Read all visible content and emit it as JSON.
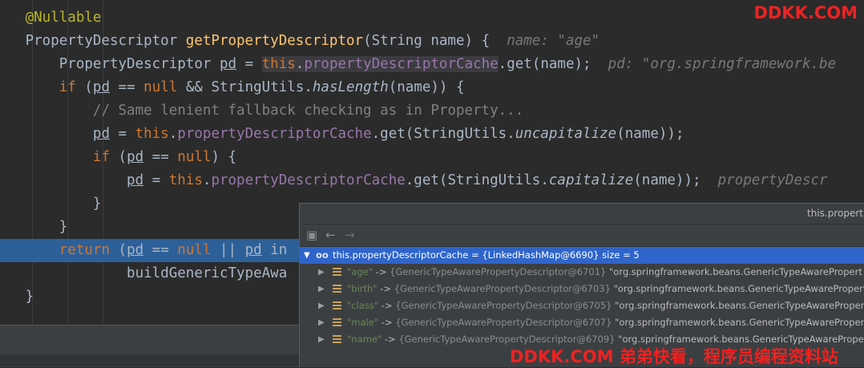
{
  "colors": {
    "editor_bg": "#2b2b2b",
    "execution_line": "#2d6099",
    "keyword": "#cc7832",
    "method": "#ffc66d",
    "field": "#9876aa",
    "annotation": "#bbb529",
    "comment": "#808080",
    "selection": "#2f65ca",
    "watermark": "#ee2222"
  },
  "code": {
    "l1": {
      "annotation": "@Nullable"
    },
    "l2": {
      "type": "PropertyDescriptor ",
      "method": "getPropertyDescriptor",
      "params": "(String name) {",
      "hint": "name: \"age\""
    },
    "l3": {
      "type": "PropertyDescriptor ",
      "var": "pd",
      "eq": " = ",
      "this": "this",
      "dot": ".",
      "field": "propertyDescriptorCache",
      "rest": ".get(name);",
      "hint": "pd: \"org.springframework.be"
    },
    "l4": {
      "kw_if": "if",
      "p1": " (",
      "var": "pd",
      "p2": " == ",
      "kw_null": "null",
      "p3": " && StringUtils.",
      "method": "hasLength",
      "p4": "(name)) {"
    },
    "l5": {
      "comment": "// Same lenient fallback checking as in Property..."
    },
    "l6": {
      "var": "pd",
      "p1": " = ",
      "this": "this",
      "dot": ".",
      "field": "propertyDescriptorCache",
      "p2": ".get(StringUtils.",
      "method": "uncapitalize",
      "p3": "(name));"
    },
    "l7": {
      "kw_if": "if",
      "p1": " (",
      "var": "pd",
      "p2": " == ",
      "kw_null": "null",
      "p3": ") {"
    },
    "l8": {
      "var": "pd",
      "p1": " = ",
      "this": "this",
      "dot": ".",
      "field": "propertyDescriptorCache",
      "p2": ".get(StringUtils.",
      "method": "capitalize",
      "p3": "(name));",
      "hint": "propertyDescr"
    },
    "l9": {
      "brace": "}"
    },
    "l10": {
      "brace": "}"
    },
    "l11": {
      "kw_return": "return",
      "p1": " (",
      "var1": "pd",
      "p2": " == ",
      "kw_null": "null",
      "p3": " || ",
      "var2": "pd",
      "p4": " in"
    },
    "l12": {
      "text": "buildGenericTypeAwa"
    },
    "l13": {
      "brace": "}"
    }
  },
  "watermark": {
    "top": "DDKK.COM",
    "bottom": "DDKK.COM 弟弟快看，程序员编程资料站"
  },
  "popup": {
    "title": "this.propert",
    "toolbar": {
      "bookmark_icon": "bookmark-icon",
      "back_icon": "arrow-left-icon",
      "forward_icon": "arrow-right-icon"
    },
    "root": {
      "icon": "watch-icon",
      "text": "this.propertyDescriptorCache = {LinkedHashMap@6690}  size = 5"
    },
    "entries": [
      {
        "key": "\"age\"",
        "arrow": " -> ",
        "ref": "{GenericTypeAwarePropertyDescriptor@6701}",
        "value": " \"org.springframework.beans.GenericTypeAwarePropert"
      },
      {
        "key": "\"birth\"",
        "arrow": " -> ",
        "ref": "{GenericTypeAwarePropertyDescriptor@6703}",
        "value": " \"org.springframework.beans.GenericTypeAwarePropert"
      },
      {
        "key": "\"class\"",
        "arrow": " -> ",
        "ref": "{GenericTypeAwarePropertyDescriptor@6705}",
        "value": " \"org.springframework.beans.GenericTypeAwarePropert"
      },
      {
        "key": "\"male\"",
        "arrow": " -> ",
        "ref": "{GenericTypeAwarePropertyDescriptor@6707}",
        "value": " \"org.springframework.beans.GenericTypeAwarePropert"
      },
      {
        "key": "\"name\"",
        "arrow": " -> ",
        "ref": "{GenericTypeAwarePropertyDescriptor@6709}",
        "value": " \"org.springframework.beans.GenericTypeAwarePrope"
      }
    ]
  }
}
